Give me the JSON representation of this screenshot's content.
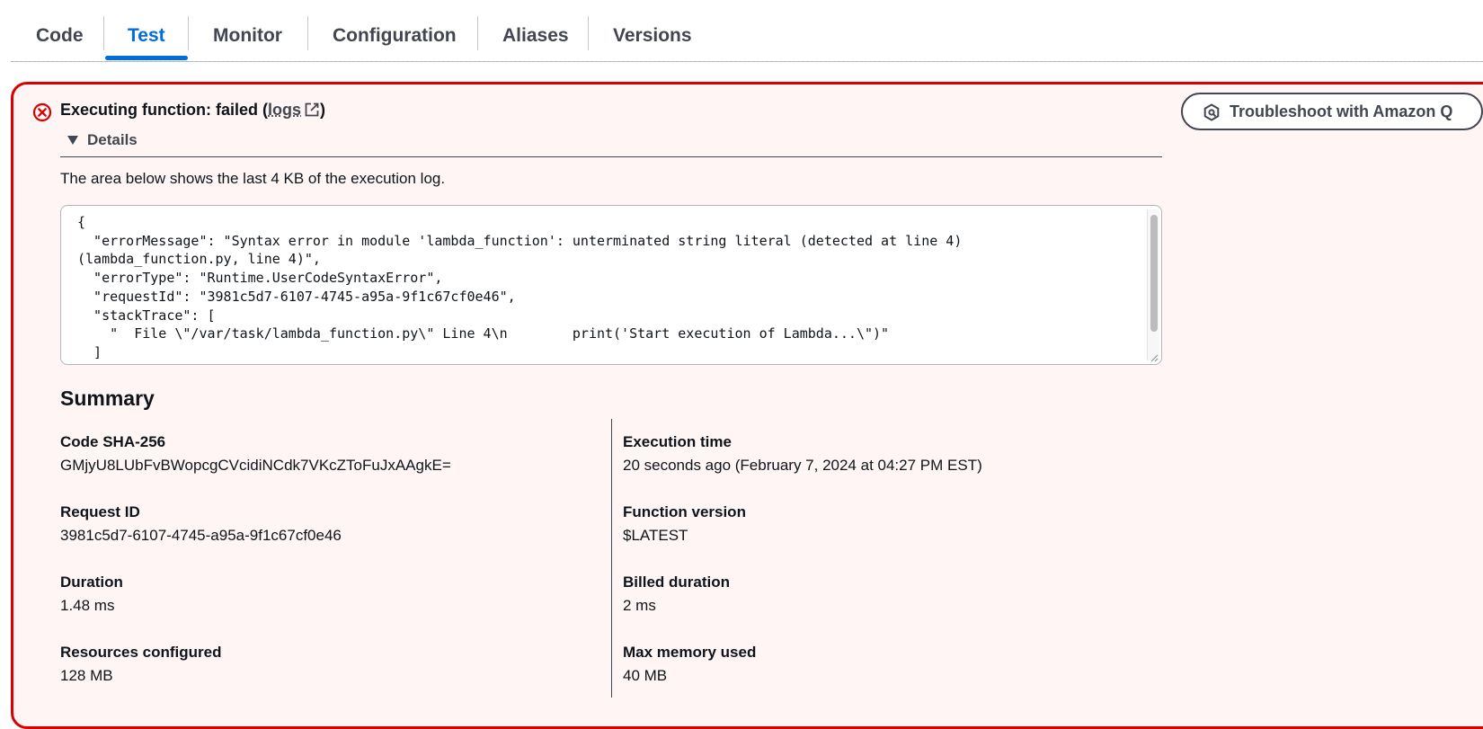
{
  "tabs": [
    {
      "label": "Code",
      "active": false
    },
    {
      "label": "Test",
      "active": true
    },
    {
      "label": "Monitor",
      "active": false
    },
    {
      "label": "Configuration",
      "active": false
    },
    {
      "label": "Aliases",
      "active": false
    },
    {
      "label": "Versions",
      "active": false
    }
  ],
  "alert": {
    "title_prefix": "Executing function: failed (",
    "logs_link": "logs",
    "title_suffix": ")",
    "status": "error",
    "troubleshoot_button": "Troubleshoot with Amazon Q",
    "details_label": "Details",
    "log_description": "The area below shows the last 4 KB of the execution log.",
    "log_text": "{\n  \"errorMessage\": \"Syntax error in module 'lambda_function': unterminated string literal (detected at line 4)\n(lambda_function.py, line 4)\",\n  \"errorType\": \"Runtime.UserCodeSyntaxError\",\n  \"requestId\": \"3981c5d7-6107-4745-a95a-9f1c67cf0e46\",\n  \"stackTrace\": [\n    \"  File \\\"/var/task/lambda_function.py\\\" Line 4\\n        print('Start execution of Lambda...\\\")\"\n  ]\n}"
  },
  "summary": {
    "heading": "Summary",
    "left": [
      {
        "key": "Code SHA-256",
        "value": "GMjyU8LUbFvBWopcgCVcidiNCdk7VKcZToFuJxAAgkE="
      },
      {
        "key": "Request ID",
        "value": "3981c5d7-6107-4745-a95a-9f1c67cf0e46"
      },
      {
        "key": "Duration",
        "value": "1.48 ms"
      },
      {
        "key": "Resources configured",
        "value": "128 MB"
      }
    ],
    "right": [
      {
        "key": "Execution time",
        "value": "20 seconds ago (February 7, 2024 at 04:27 PM EST)"
      },
      {
        "key": "Function version",
        "value": "$LATEST"
      },
      {
        "key": "Billed duration",
        "value": "2 ms"
      },
      {
        "key": "Max memory used",
        "value": "40 MB"
      }
    ]
  },
  "colors": {
    "error": "#db0000",
    "panel_background": "#fff5f5",
    "accent": "#006ce0",
    "text": "#0f141a",
    "muted": "#424650"
  },
  "icons": {
    "error": "error-circle-icon",
    "external": "external-link-icon",
    "amazon_q": "amazon-q-icon",
    "caret": "caret-down-icon"
  }
}
